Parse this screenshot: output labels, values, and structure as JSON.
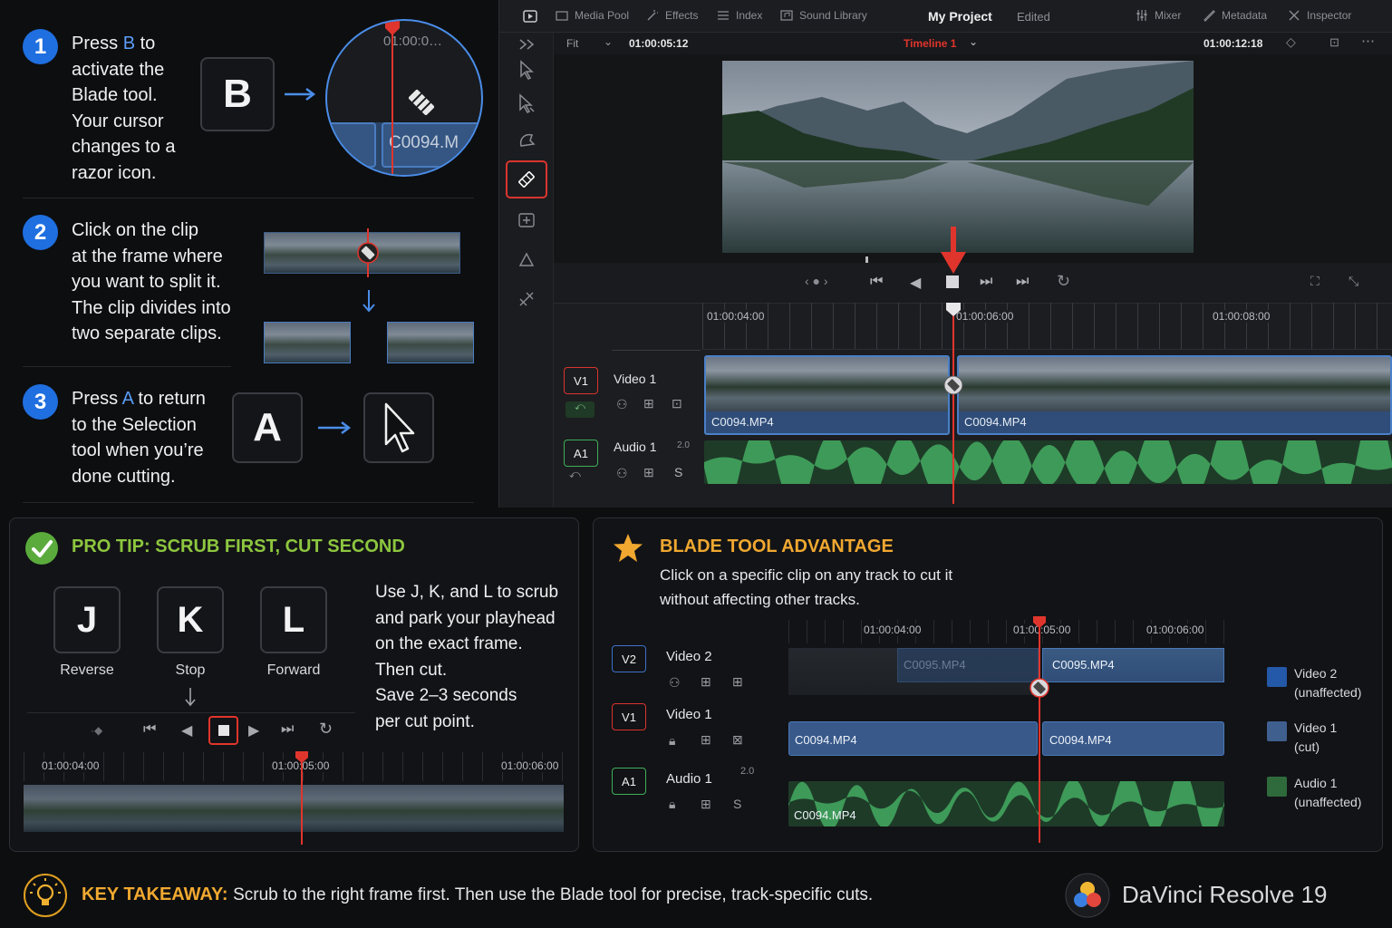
{
  "steps": [
    {
      "num": "1",
      "pre": "Press ",
      "key": "B",
      "post": " to activate the Blade tool. Your cursor changes to a razor icon.",
      "lines": [
        "activate the",
        "Blade tool.",
        "Your cursor",
        "changes to a",
        "razor icon."
      ]
    },
    {
      "num": "2",
      "lines": [
        "Click on the clip",
        "at the frame where",
        "you want to split it.",
        "The clip divides into",
        "two separate clips."
      ]
    },
    {
      "num": "3",
      "pre": "Press ",
      "key": "A",
      "post": " to return",
      "lines": [
        "to the Selection",
        "tool when you’re",
        "done cutting."
      ]
    }
  ],
  "step1_first": {
    "pre": "Press ",
    "key": "B",
    "post": " to"
  },
  "step3_first": {
    "pre": "Press ",
    "key": "A",
    "post": " to return"
  },
  "keys": {
    "b": "B",
    "a": "A"
  },
  "zoom": {
    "timecode": "01:00:0…",
    "clip": "C0094.M"
  },
  "resolve": {
    "tabs": {
      "media_pool": "Media Pool",
      "effects": "Effects",
      "index": "Index",
      "sound_library": "Sound Library",
      "mixer": "Mixer",
      "metadata": "Metadata",
      "inspector": "Inspector"
    },
    "project": "My Project",
    "status": "Edited",
    "fit": "Fit",
    "timecode_left": "01:00:05:12",
    "timeline": "Timeline 1",
    "timecode_right": "01:00:12:18",
    "ruler": [
      "01:00:04:00",
      "01:00:06:00",
      "01:00:08:00"
    ],
    "tracks": {
      "v1_badge": "V1",
      "v1_name": "Video 1",
      "a1_badge": "A1",
      "a1_name": "Audio 1",
      "a1_ch": "2.0",
      "a1_solo": "S"
    },
    "clip1": "C0094.MP4",
    "clip2": "C0094.MP4"
  },
  "pro_tip": {
    "title": "PRO TIP: SCRUB FIRST, CUT SECOND",
    "keys": [
      {
        "k": "J",
        "label": "Reverse"
      },
      {
        "k": "K",
        "label": "Stop"
      },
      {
        "k": "L",
        "label": "Forward"
      }
    ],
    "lines": [
      "Use J, K, and L to scrub",
      "and park your playhead",
      "on the exact frame.",
      "Then cut.",
      "Save 2–3 seconds",
      "per cut point."
    ],
    "ruler": [
      "01:00:04:00",
      "01:00:05:00",
      "01:00:06:00"
    ]
  },
  "advantage": {
    "title": "BLADE TOOL ADVANTAGE",
    "lines": [
      "Click on a specific clip on any track to cut it",
      "without affecting other tracks."
    ],
    "ruler": [
      "01:00:04:00",
      "01:00:05:00",
      "01:00:06:00"
    ],
    "tracks": [
      {
        "badge": "V2",
        "name": "Video 2"
      },
      {
        "badge": "V1",
        "name": "Video 1"
      },
      {
        "badge": "A1",
        "name": "Audio 1",
        "ch": "2.0"
      }
    ],
    "clips": {
      "v2a": "C0095.MP4",
      "v2b": "C0095.MP4",
      "v1a": "C0094.MP4",
      "v1b": "C0094.MP4",
      "a1": "C0094.MP4"
    },
    "legend": [
      {
        "title": "Video 2",
        "sub": "(unaffected)",
        "color": "#2458a8"
      },
      {
        "title": "Video 1",
        "sub": "(cut)",
        "color": "#3f5f8f"
      },
      {
        "title": "Audio 1",
        "sub": "(unaffected)",
        "color": "#2f6a3c"
      }
    ]
  },
  "takeaway": {
    "label": "KEY TAKEAWAY:",
    "text": "Scrub to the right frame first. Then use the Blade tool for precise, track-specific cuts."
  },
  "brand": "DaVinci Resolve 19",
  "colors": {
    "accent_blue": "#1f6fe0",
    "playhead_red": "#e0352c",
    "tip_green": "#8dc63f",
    "gold": "#f0a830"
  }
}
